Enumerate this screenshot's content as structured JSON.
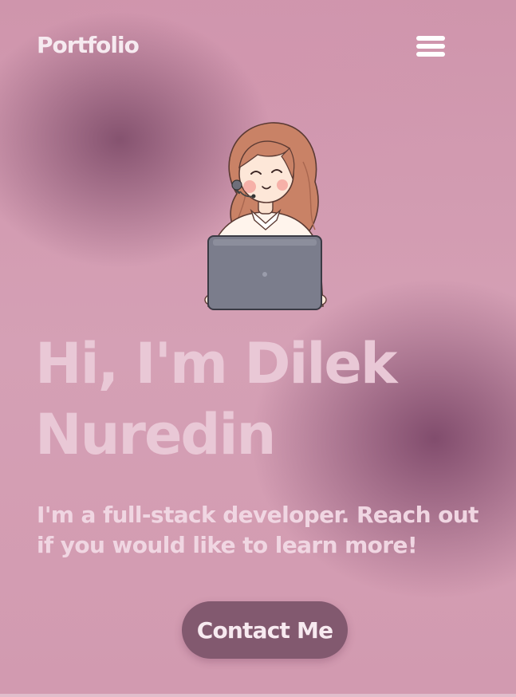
{
  "header": {
    "logo": "Portfolio",
    "menu_icon": "hamburger-menu-icon"
  },
  "hero": {
    "illustration": "developer-girl-with-laptop-illustration",
    "title": "Hi, I'm Dilek Nuredin",
    "subtitle": "I'm a full-stack developer. Reach out if you would like to learn more!",
    "cta_label": "Contact Me"
  },
  "colors": {
    "background": "#d49db3",
    "background_dark": "#7d4869",
    "title_text": "#e9c8d6",
    "button_bg": "#82596f",
    "button_text": "#f7eaf0"
  }
}
